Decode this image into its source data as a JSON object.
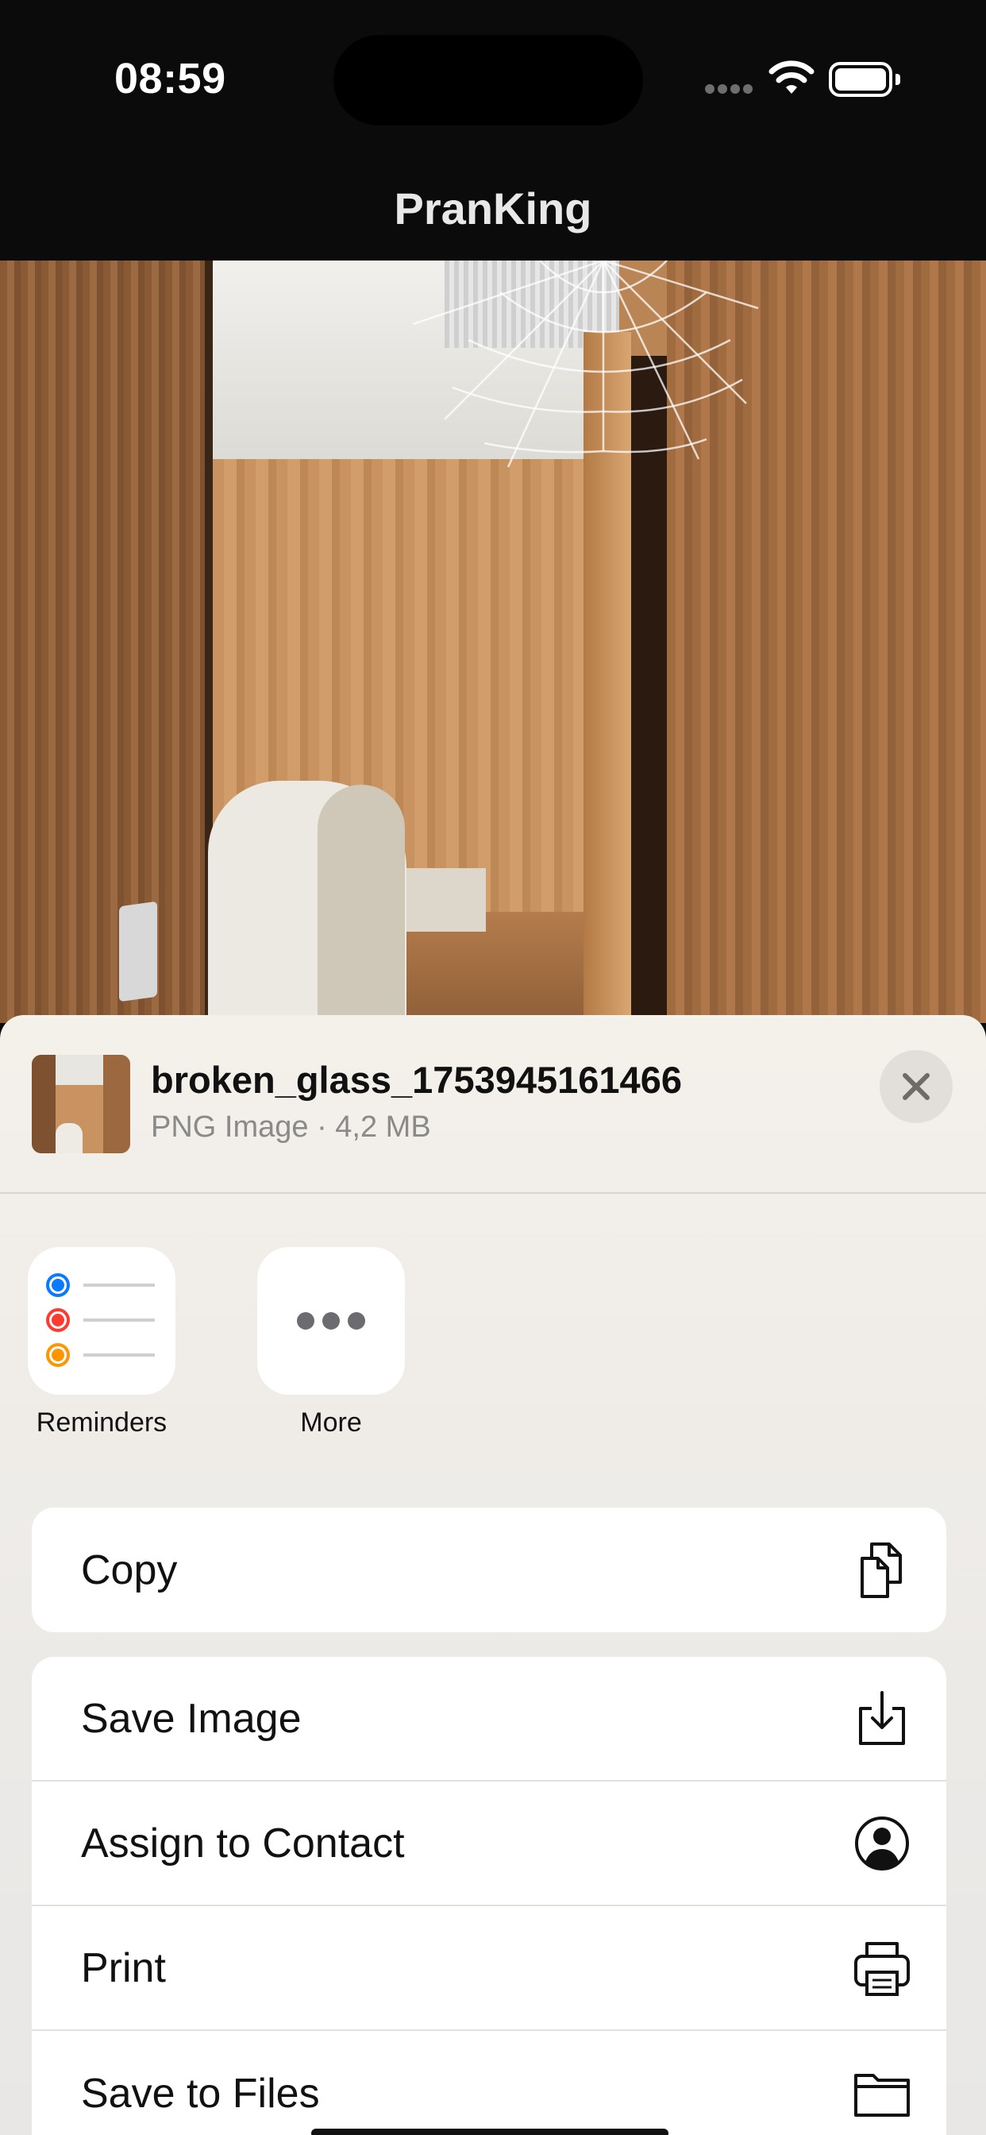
{
  "status_bar": {
    "time": "08:59"
  },
  "nav": {
    "title": "PranKing"
  },
  "share_sheet": {
    "file_name": "broken_glass_1753945161466",
    "file_meta": "PNG Image · 4,2 MB",
    "apps": [
      {
        "label": "Reminders",
        "icon": "reminders-icon"
      },
      {
        "label": "More",
        "icon": "more-icon"
      }
    ],
    "actions_group1": [
      {
        "label": "Copy",
        "icon": "copy-icon"
      }
    ],
    "actions_group2": [
      {
        "label": "Save Image",
        "icon": "save-image-icon"
      },
      {
        "label": "Assign to Contact",
        "icon": "contact-icon"
      },
      {
        "label": "Print",
        "icon": "printer-icon"
      },
      {
        "label": "Save to Files",
        "icon": "folder-icon"
      }
    ]
  },
  "colors": {
    "reminder_blue": "#0a7aff",
    "reminder_red": "#ff3b30",
    "reminder_orange": "#ff9500"
  }
}
